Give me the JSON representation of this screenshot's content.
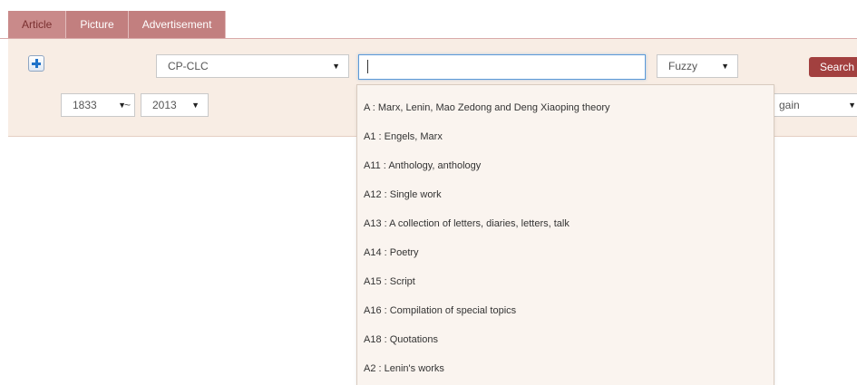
{
  "tabs": [
    {
      "label": "Article",
      "active": true
    },
    {
      "label": "Picture",
      "active": false
    },
    {
      "label": "Advertisement",
      "active": false
    }
  ],
  "search": {
    "classification_select": "CP-CLC",
    "input_value": "",
    "match_select": "Fuzzy",
    "search_label": "Search",
    "year_from": "1833",
    "year_separator": "~",
    "year_to": "2013",
    "again_select_partial": "gain"
  },
  "dropdown": {
    "items": [
      "A : Marx, Lenin, Mao Zedong and Deng Xiaoping theory",
      "A1 : Engels, Marx",
      "A11 : Anthology, anthology",
      "A12 : Single work",
      "A13 : A collection of letters, diaries, letters, talk",
      "A14 : Poetry",
      "A15 : Script",
      "A16 : Compilation of special topics",
      "A18 : Quotations",
      "A2 : Lenin's works"
    ]
  },
  "icons": {
    "add": "plus-icon",
    "caret": "caret-down-icon"
  },
  "colors": {
    "tab_bg": "#c27f7f",
    "panel_bg": "#f8ede4",
    "search_button": "#a2403f",
    "input_focus": "#5b9ad8"
  }
}
